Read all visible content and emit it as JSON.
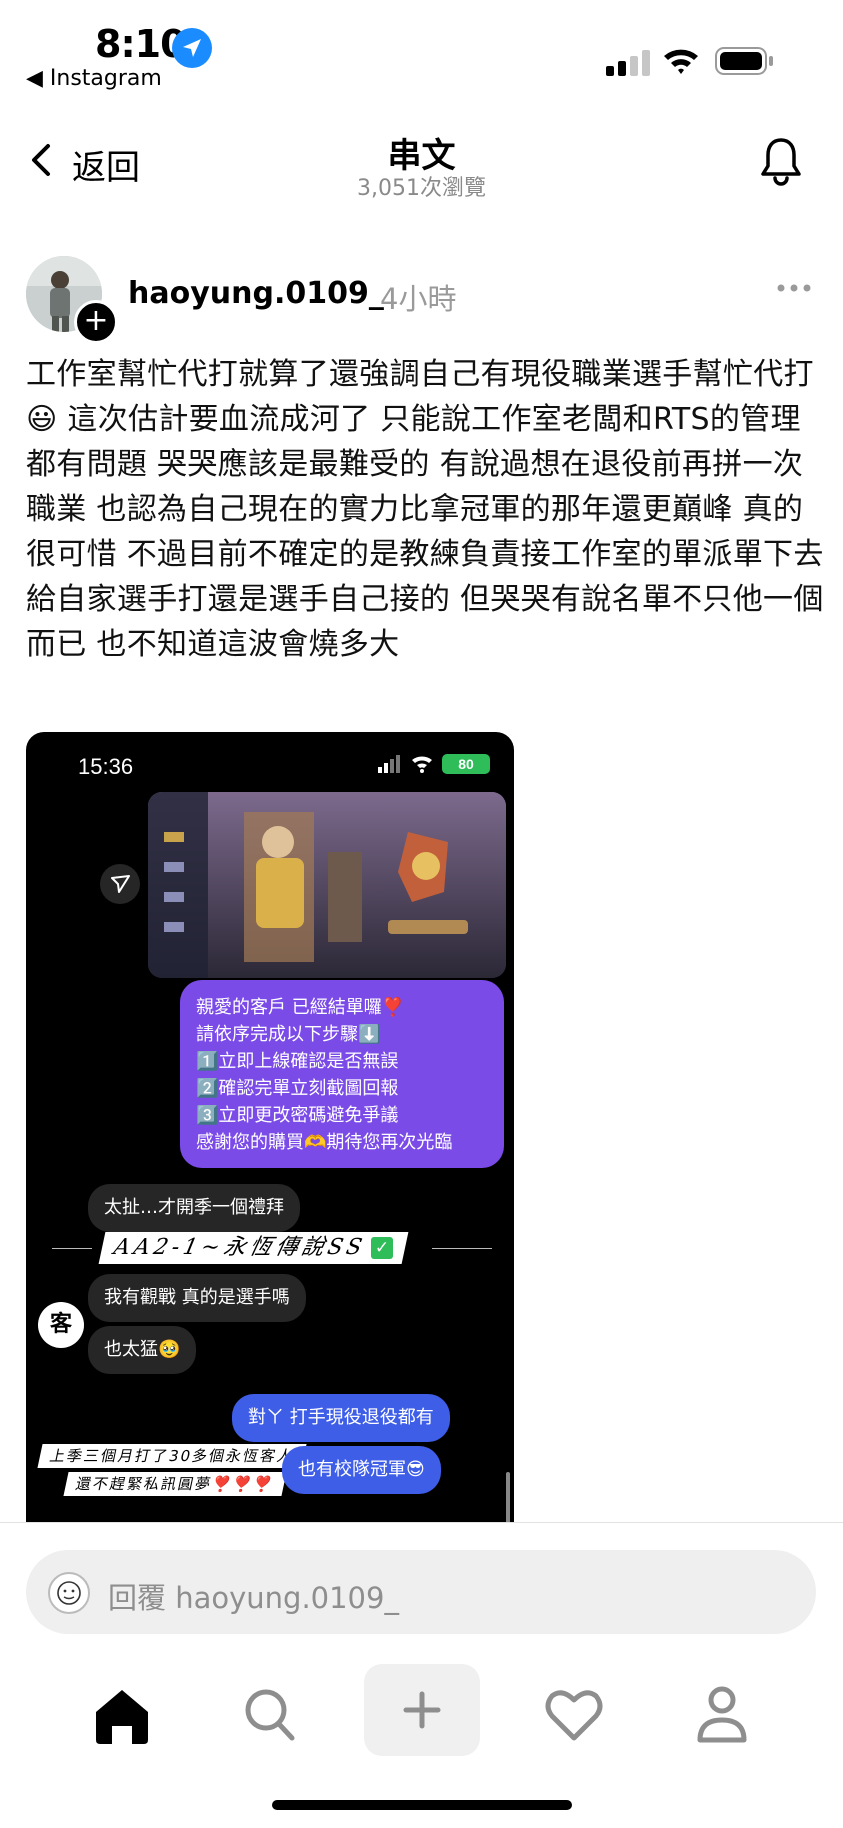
{
  "status_bar": {
    "time": "8:10",
    "back_app": "◀ Instagram",
    "accent_color": "#1a8cff"
  },
  "header": {
    "back_label": "返回",
    "title": "串文",
    "subtitle": "3,051次瀏覽",
    "icons": [
      "chevron-left-icon",
      "bell-icon"
    ]
  },
  "post": {
    "username": "haoyung.0109_",
    "time_ago": "4小時",
    "text_part1": "工作室幫忙代打就算了還強調自己有現役職業選手幫忙代打",
    "emoji": "😃",
    "text_part2": " 這次估計要血流成河了 只能說工作室老闆和RTS的管理都有問題 哭哭應該是最難受的 有說過想在退役前再拼一次職業 也認為自己現在的實力比拿冠軍的那年還更巔峰 真的很可惜 不過目前不確定的是教練負責接工作室的單派單下去給自家選手打還是選手自己接的 但哭哭有說名單不只他一個而已 也不知道這波會燒多大"
  },
  "screenshot": {
    "time": "15:36",
    "battery": "80",
    "order_message": "親愛的客戶 已經結單囉❣️\n請依序完成以下步驟⬇️\n1️⃣立即上線確認是否無誤\n2️⃣確認完單立刻截圖回報\n3️⃣立即更改密碼避免爭議\n感謝您的購買🫶期待您再次光臨",
    "msg_1": "太扯…才開季一個禮拜",
    "banner": "AA2-1~永恆傳說SS",
    "msg_2": "我有觀戰 真的是選手嗎",
    "msg_3": "也太猛🥹",
    "customer_label": "客",
    "reply_1": "對ㄚ 打手現役退役都有",
    "stripe_1": "上季三個月打了30多個永恆客人",
    "stripe_2": "還不趕緊私訊圓夢❣️❣️❣️",
    "reply_2": "也有校隊冠軍😎"
  },
  "reply_bar": {
    "placeholder": "回覆 haoyung.0109_"
  },
  "tab_bar": {
    "icons": [
      "home-icon",
      "search-icon",
      "plus-icon",
      "heart-icon",
      "profile-icon"
    ]
  }
}
